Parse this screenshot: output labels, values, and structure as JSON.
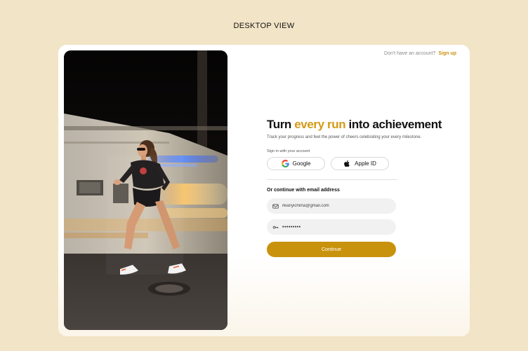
{
  "view_label": "DESKTOP VIEW",
  "colors": {
    "page_background": "#f2e4c6",
    "accent": "#c9920c",
    "headline_accent": "#d39a16"
  },
  "header": {
    "prompt": "Don't have an account?",
    "signup_label": "Sign up"
  },
  "hero": {
    "headline_start": "Turn ",
    "headline_accent": "every run",
    "headline_end": " into achievement",
    "subtitle": "Track your progress and feel the power of cheers celebrating your every milestone."
  },
  "social": {
    "label": "Sign in with your account",
    "buttons": [
      {
        "label": "Google",
        "icon": "google-icon"
      },
      {
        "label": "Apple ID",
        "icon": "apple-icon"
      }
    ]
  },
  "email_section": {
    "label": "Or continue with email address",
    "email": {
      "value": "ifeanyichima@gmail.com",
      "icon": "mail-icon"
    },
    "password": {
      "value": "•••••••••",
      "icon": "key-icon"
    },
    "continue_label": "Continue"
  }
}
